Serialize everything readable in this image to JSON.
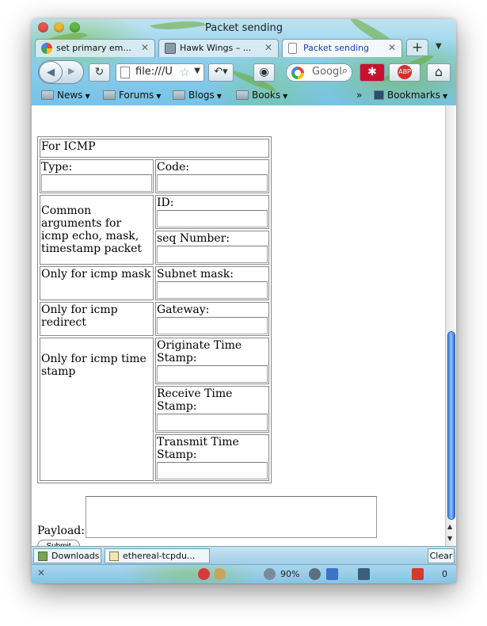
{
  "window": {
    "title": "Packet sending"
  },
  "tabs": [
    {
      "label": "set primary em...",
      "active": false,
      "favicon": "google-icon"
    },
    {
      "label": "Hawk Wings – ...",
      "active": false,
      "favicon": "hawk-wings-icon"
    },
    {
      "label": "Packet sending",
      "active": true,
      "favicon": "blank-page-icon"
    }
  ],
  "tab_new_label": "+",
  "tab_close_glyph": "✕",
  "nav": {
    "url": "file:///U",
    "search_placeholder": "Googl",
    "reload_glyph": "↻",
    "home_glyph": "⌂",
    "abp_label": "ABP"
  },
  "bookmarks": [
    {
      "label": "News"
    },
    {
      "label": "Forums"
    },
    {
      "label": "Blogs"
    },
    {
      "label": "Books"
    }
  ],
  "bookmarks_overflow": "»",
  "bookmarks_menu": "Bookmarks",
  "form": {
    "section_title": "For ICMP",
    "type_label": "Type:",
    "code_label": "Code:",
    "common_label": "Common arguments for icmp echo, mask, timestamp packet",
    "id_label": "ID:",
    "seq_label": "seq Number:",
    "mask_only_label": "Only for icmp mask",
    "subnet_label": "Subnet mask:",
    "redirect_only_label": "Only for icmp redirect",
    "gateway_label": "Gateway:",
    "timestamp_only_label": "Only for icmp time stamp",
    "originate_label": "Originate Time Stamp:",
    "receive_label": "Receive Time Stamp:",
    "transmit_label": "Transmit Time Stamp:",
    "payload_label": "Payload:",
    "submit_label": "Submit"
  },
  "download_bar": {
    "downloads_label": "Downloads",
    "file_label": "ethereal-tcpdu...",
    "clear_label": "Clear"
  },
  "status_bar": {
    "close_glyph": "✕",
    "zoom": "90%",
    "mail_count": "0"
  },
  "colors": {
    "active_tab_text": "#1a3fae",
    "scroll_thumb": "#3d7de2",
    "chrome_sky": "#8fd0ec"
  }
}
